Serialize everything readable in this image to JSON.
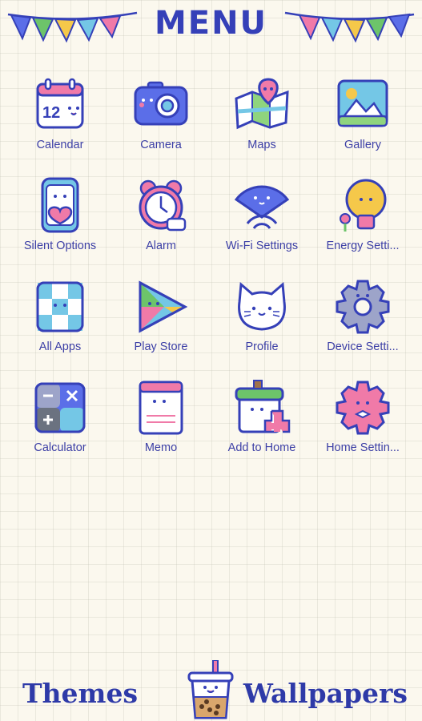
{
  "header": {
    "title": "MENU"
  },
  "apps": [
    {
      "label": "Calendar",
      "icon": "calendar-icon"
    },
    {
      "label": "Camera",
      "icon": "camera-icon"
    },
    {
      "label": "Maps",
      "icon": "maps-icon"
    },
    {
      "label": "Gallery",
      "icon": "gallery-icon"
    },
    {
      "label": "Silent Options",
      "icon": "silent-options-icon"
    },
    {
      "label": "Alarm",
      "icon": "alarm-icon"
    },
    {
      "label": "Wi-Fi Settings",
      "icon": "wifi-icon"
    },
    {
      "label": "Energy Setti...",
      "icon": "lightbulb-icon"
    },
    {
      "label": "All Apps",
      "icon": "all-apps-icon"
    },
    {
      "label": "Play Store",
      "icon": "play-store-icon"
    },
    {
      "label": "Profile",
      "icon": "cat-profile-icon"
    },
    {
      "label": "Device Setti...",
      "icon": "gear-icon"
    },
    {
      "label": "Calculator",
      "icon": "calculator-icon"
    },
    {
      "label": "Memo",
      "icon": "memo-icon"
    },
    {
      "label": "Add to Home",
      "icon": "add-home-icon"
    },
    {
      "label": "Home Settin...",
      "icon": "pink-gear-icon"
    }
  ],
  "calendar": {
    "day": "12"
  },
  "footer": {
    "themes_label": "Themes",
    "wallpapers_label": "Wallpapers"
  },
  "colors": {
    "accent": "#3540b8",
    "label": "#3c3fa6",
    "background": "#fbf8ee"
  }
}
